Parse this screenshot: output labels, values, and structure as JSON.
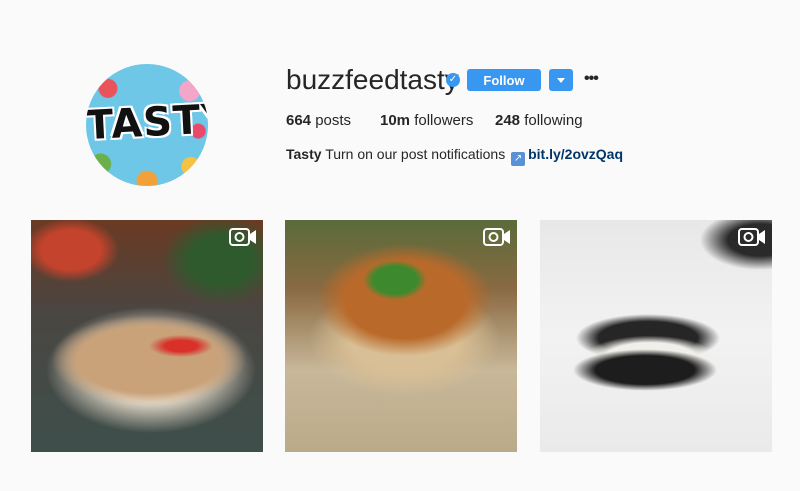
{
  "profile": {
    "avatar_text": "TASTY",
    "username": "buzzfeedtasty",
    "follow_label": "Follow",
    "stats": {
      "posts_count": "664",
      "posts_label": "posts",
      "followers_count": "10m",
      "followers_label": "followers",
      "following_count": "248",
      "following_label": "following"
    },
    "bio": {
      "name": "Tasty",
      "text": "Turn on our post notifications",
      "link_icon": "↗",
      "link": "bit.ly/2ovzQaq"
    }
  },
  "more_glyph": "•••",
  "verified_glyph": "✓",
  "posts": [
    {
      "type": "video",
      "icon": "video-camera-icon"
    },
    {
      "type": "video",
      "icon": "video-camera-icon"
    },
    {
      "type": "video",
      "icon": "video-camera-icon"
    }
  ],
  "colors": {
    "accent": "#3897f0",
    "background": "#fafafa",
    "link": "#003569"
  }
}
